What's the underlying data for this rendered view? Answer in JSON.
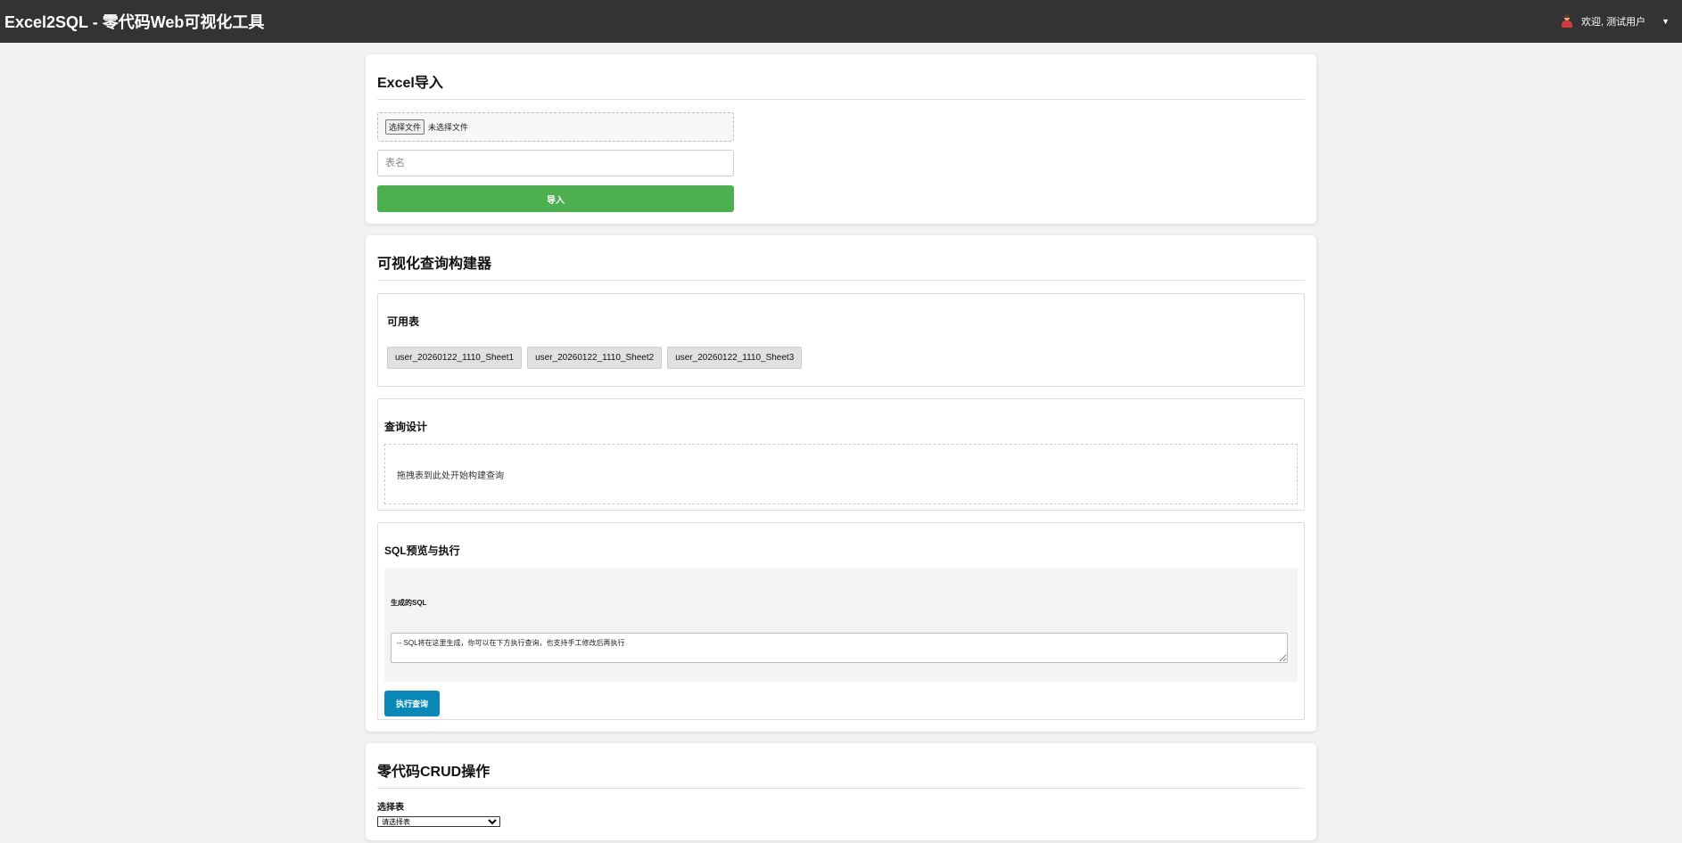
{
  "header": {
    "title": "Excel2SQL - 零代码Web可视化工具",
    "welcome": "欢迎, 测试用户",
    "caret": "▼"
  },
  "excel_import": {
    "title": "Excel导入",
    "file_button": "选择文件",
    "file_status": "未选择文件",
    "table_name_placeholder": "表名",
    "import_button": "导入"
  },
  "query_builder": {
    "title": "可视化查询构建器",
    "tables_title": "可用表",
    "tables": [
      "user_20260122_1110_Sheet1",
      "user_20260122_1110_Sheet2",
      "user_20260122_1110_Sheet3"
    ],
    "design_title": "查询设计",
    "drop_hint": "拖拽表到此处开始构建查询",
    "sql_title": "SQL预览与执行",
    "generated_label": "生成的SQL",
    "sql_text": "-- SQL将在这里生成，你可以在下方执行查询，也支持手工修改后再执行",
    "execute_button": "执行查询"
  },
  "crud": {
    "title": "零代码CRUD操作",
    "select_label": "选择表",
    "select_value": "请选择表"
  }
}
